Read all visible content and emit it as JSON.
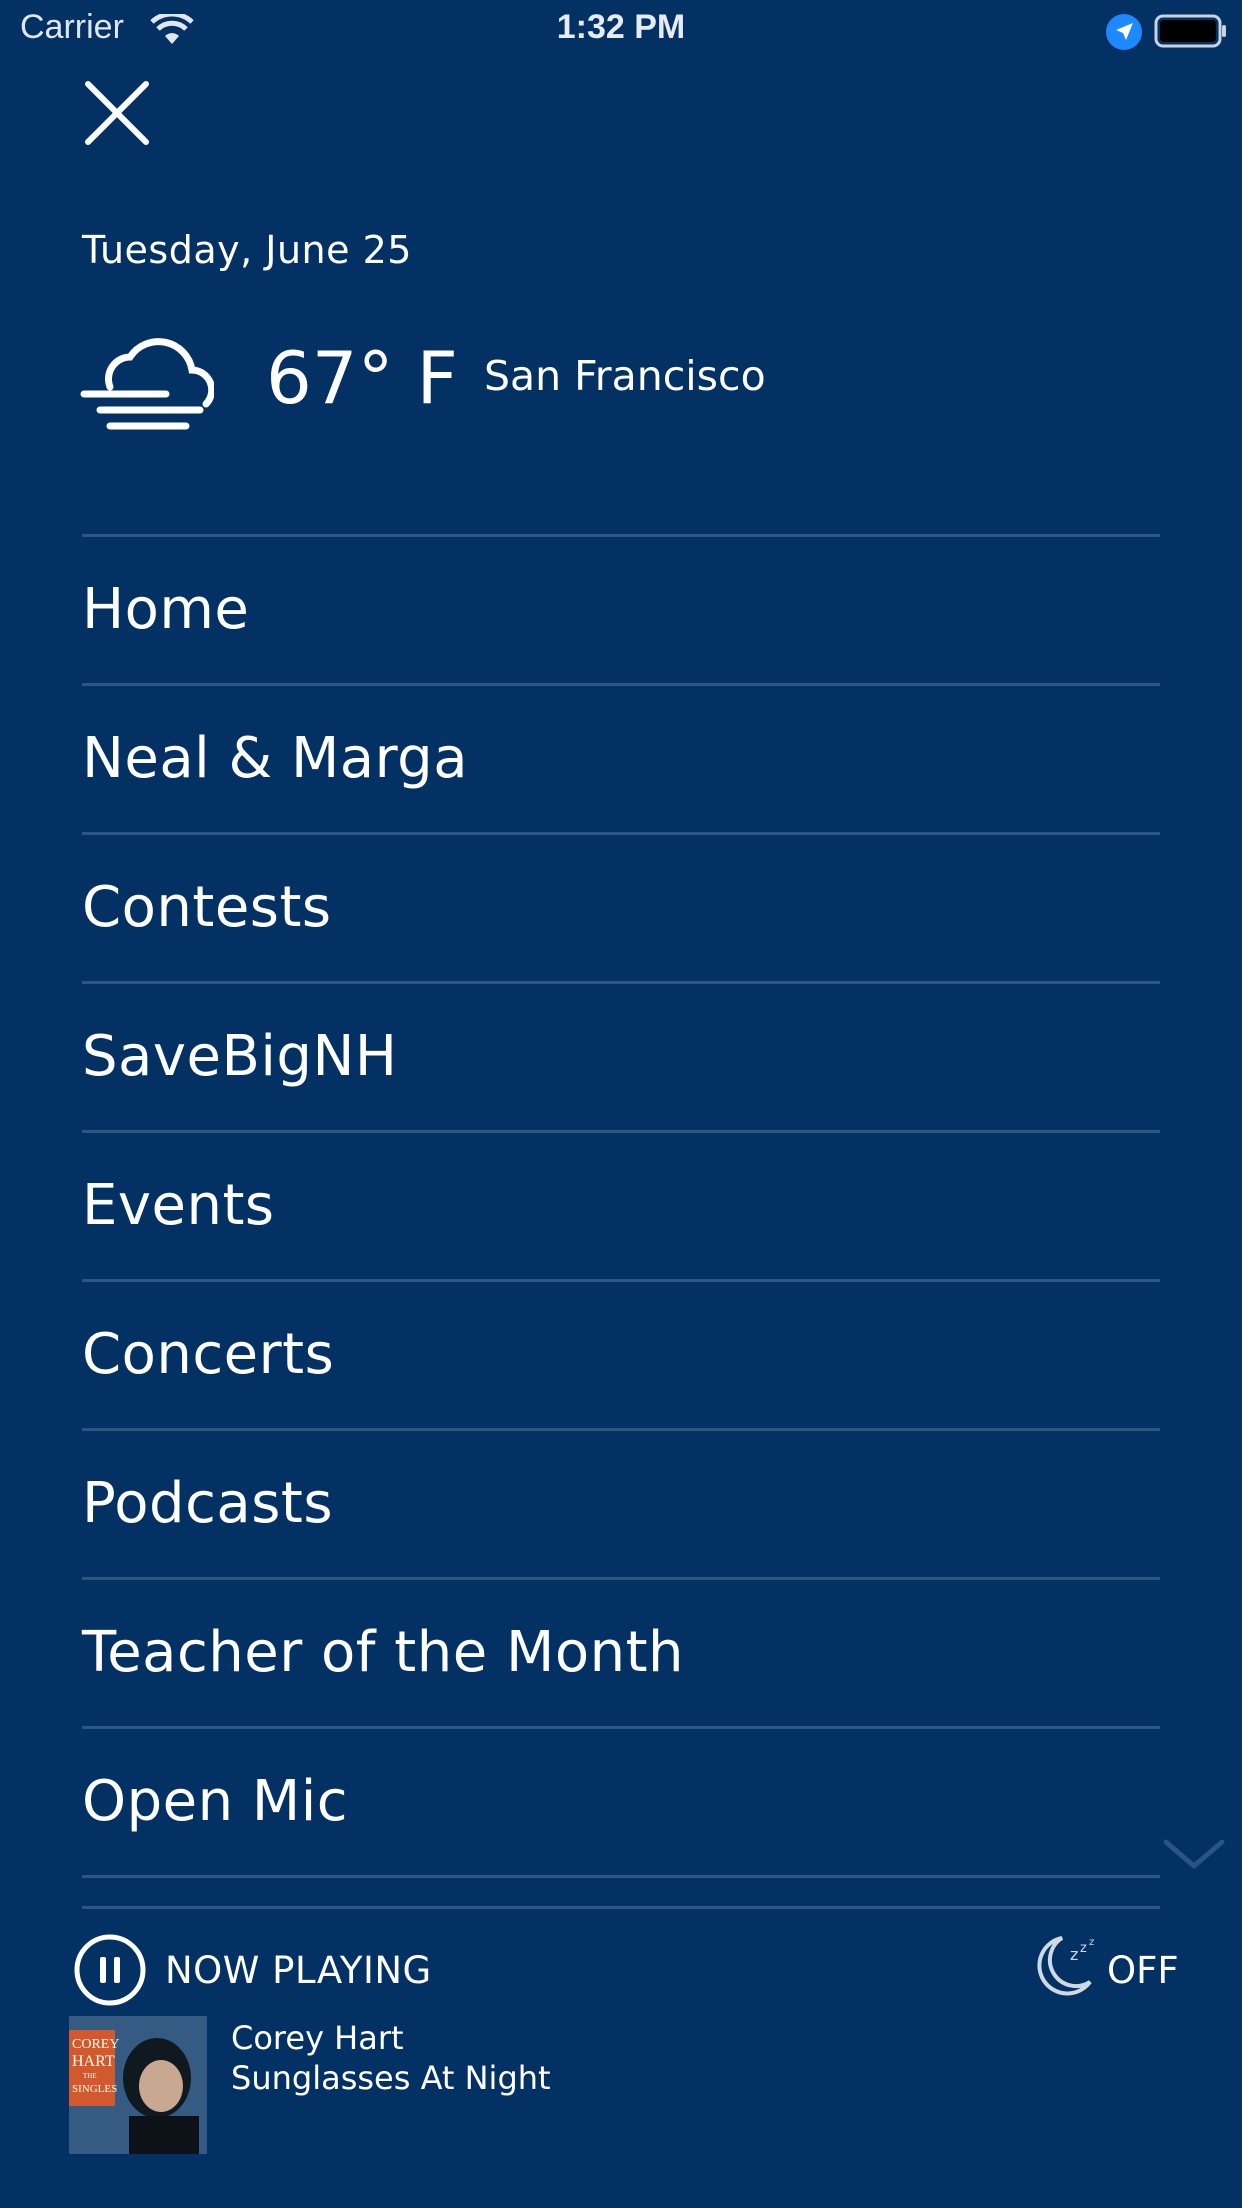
{
  "status_bar": {
    "carrier": "Carrier",
    "time": "1:32 PM"
  },
  "header": {
    "date": "Tuesday, June 25",
    "weather": {
      "temperature": "67° F",
      "location": "San Francisco",
      "icon": "cloud-fog-icon"
    }
  },
  "menu": {
    "items": [
      {
        "label": "Home"
      },
      {
        "label": "Neal & Marga"
      },
      {
        "label": "Contests"
      },
      {
        "label": "SaveBigNH"
      },
      {
        "label": "Events"
      },
      {
        "label": "Concerts"
      },
      {
        "label": "Podcasts"
      },
      {
        "label": "Teacher of the Month"
      },
      {
        "label": "Open Mic"
      }
    ]
  },
  "player": {
    "now_playing_label": "NOW PLAYING",
    "sleep_label": "OFF",
    "artist": "Corey Hart",
    "song": "Sunglasses At Night",
    "album_text": [
      "COREY",
      "HART",
      "THE",
      "SINGLES"
    ]
  },
  "colors": {
    "background": "#033163",
    "divider": "#2f5680",
    "accent": "#1e88ff"
  }
}
